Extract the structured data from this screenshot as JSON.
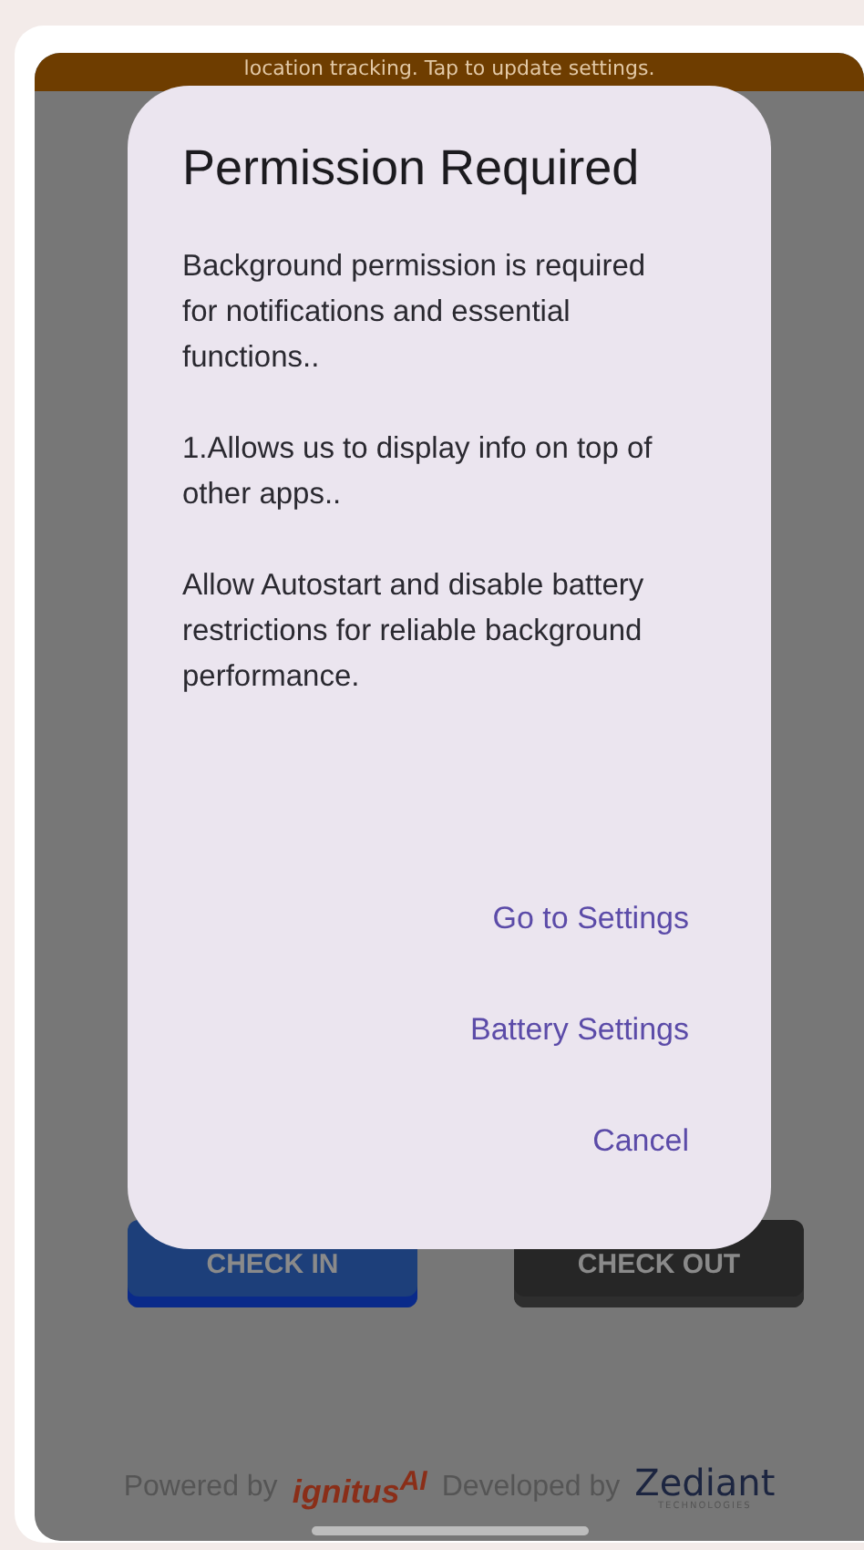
{
  "banner": {
    "text": "location tracking. Tap to update settings."
  },
  "dialog": {
    "title": "Permission Required",
    "paragraphs": [
      "Background permission is required for notifications and essential functions..",
      "1.Allows us to display info on top of other apps..",
      "Allow Autostart and disable battery restrictions for reliable background performance."
    ],
    "actions": [
      "Go to Settings",
      "Battery Settings",
      "Cancel"
    ]
  },
  "buttons": [
    {
      "label": "CHECK IN",
      "kind": "primary"
    },
    {
      "label": "CHECK OUT",
      "kind": "dark"
    }
  ],
  "footer": {
    "powered_label": "Powered by",
    "powered_brand": "ignitus$^{AI}$",
    "developed_label": "Developed by",
    "developed_brand": "Zediant",
    "developed_tagline": "TECHNOLOGIES"
  }
}
